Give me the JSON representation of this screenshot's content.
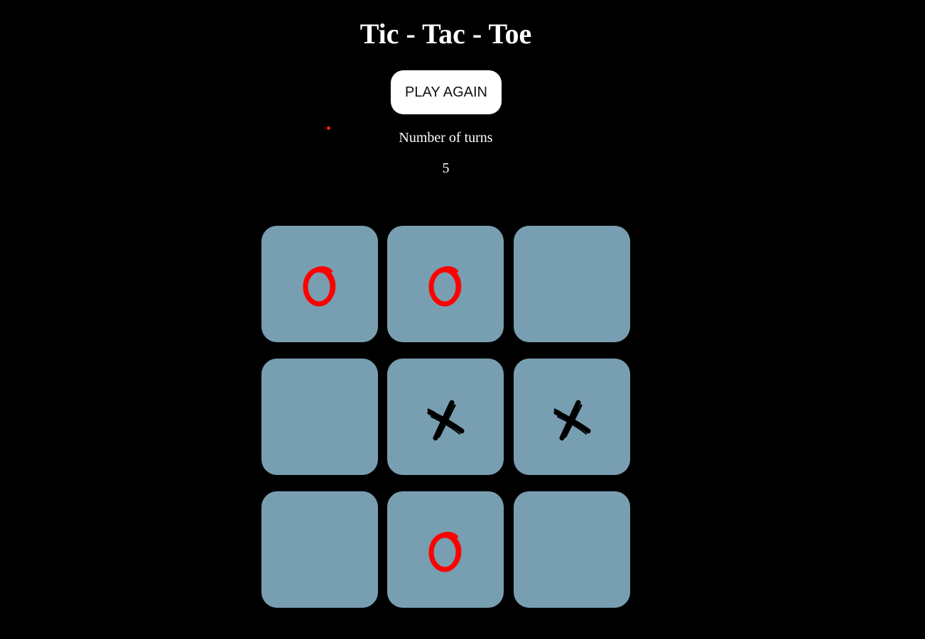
{
  "header": {
    "title": "Tic - Tac - Toe"
  },
  "controls": {
    "play_again_label": "PLAY AGAIN"
  },
  "turns": {
    "label": "Number of turns",
    "count": "5"
  },
  "board": {
    "cells": [
      "O",
      "O",
      "",
      "",
      "X",
      "X",
      "",
      "O",
      ""
    ]
  },
  "colors": {
    "background": "#000000",
    "cell": "#789eb1",
    "o_mark": "#ff0000",
    "x_mark": "#000000",
    "button": "#ffffff"
  }
}
